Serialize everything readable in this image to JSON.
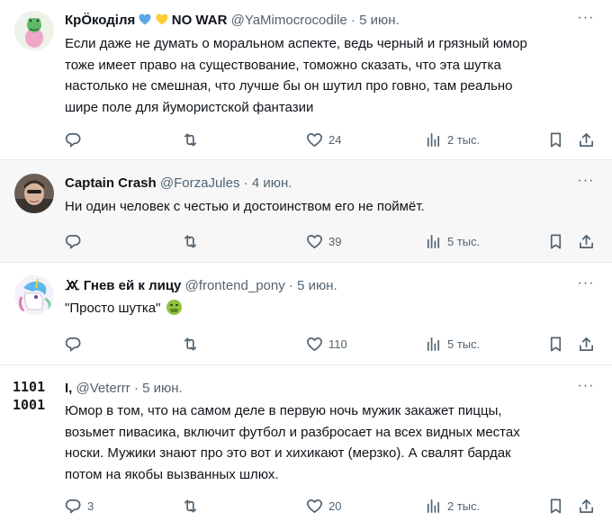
{
  "tweets": [
    {
      "name": "КрÖкоділя",
      "name_suffix": "NO WAR",
      "name_emojis": [
        "blue-heart",
        "yellow-heart"
      ],
      "handle": "@YaMimocrocodile",
      "dot": "·",
      "time": "5 июн.",
      "text": "Если даже не думать о моральном аспекте, ведь черный и грязный юмор\nтоже имеет право на существование, томожно сказать, что эта шутка\nнастолько не смешная, что лучше бы он шутил про говно, там реально\nшире поле для йумористской фантазии",
      "reply_count": "",
      "retweet_count": "",
      "like_count": "24",
      "views": "2 тыс.",
      "avatar": "frog-avatar"
    },
    {
      "name": "Captain Crash",
      "handle": "@ForzaJules",
      "dot": "·",
      "time": "4 июн.",
      "text": "Ни один человек с честью и достоинством его не поймёт.",
      "reply_count": "",
      "retweet_count": "",
      "like_count": "39",
      "views": "5 тыс.",
      "avatar": "man-photo-avatar"
    },
    {
      "name": "🝪 Гнев ей к лицу",
      "handle": "@frontend_pony",
      "dot": "·",
      "time": "5 июн.",
      "text": "\"Просто шутка\"",
      "reply_count": "",
      "retweet_count": "",
      "like_count": "110",
      "views": "5 тыс.",
      "avatar": "pony-avatar"
    },
    {
      "name": "I,",
      "handle": "@Veterrr",
      "dot": "·",
      "time": "5 июн.",
      "text": "Юмор в том, что на самом деле в первую ночь мужик закажет пиццы,\nвозьмет пивасика, включит футбол и разбросает на всех видных местах\nноски. Мужики знают про это вот и хихикают (мерзко). А свалят бардак\nпотом на якобы вызванных шлюх.",
      "reply_count": "3",
      "retweet_count": "",
      "like_count": "20",
      "views": "2 тыс.",
      "avatar_text": "1101\n1001"
    }
  ],
  "colors": {
    "text": "#0f1419",
    "secondary": "#536471",
    "divider": "#e6e9ec",
    "hover_bg": "#f7f7f7"
  },
  "icons": [
    "reply-icon",
    "retweet-icon",
    "like-icon",
    "views-icon",
    "bookmark-icon",
    "share-icon",
    "more-icon"
  ]
}
